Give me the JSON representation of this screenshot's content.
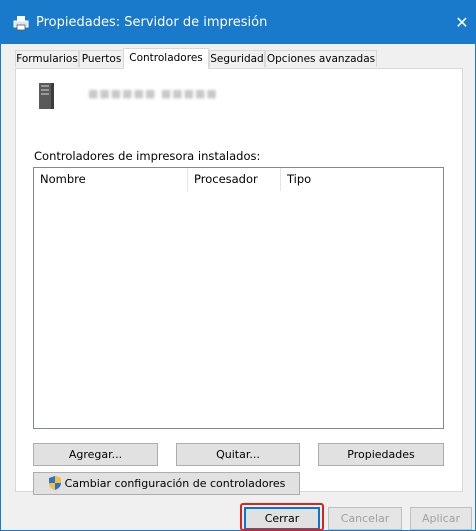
{
  "window": {
    "title": "Propiedades: Servidor de impresión",
    "close_label": "✕"
  },
  "tabs": [
    {
      "label": "Formularios"
    },
    {
      "label": "Puertos"
    },
    {
      "label": "Controladores"
    },
    {
      "label": "Seguridad"
    },
    {
      "label": "Opciones avanzadas"
    }
  ],
  "active_tab": "Controladores",
  "server": {
    "name": "■■■■■■ ■■■■■",
    "icon": "server-tower-icon"
  },
  "drivers": {
    "label": "Controladores de impresora instalados:",
    "columns": [
      "Nombre",
      "Procesador",
      "Tipo"
    ],
    "rows": []
  },
  "buttons": {
    "add": "Agregar...",
    "remove": "Quitar...",
    "properties": "Propiedades",
    "change_settings": "Cambiar configuración de controladores"
  },
  "footer": {
    "close": "Cerrar",
    "cancel": "Cancelar",
    "apply": "Aplicar"
  },
  "colors": {
    "titlebar": "#1979ca",
    "highlight": "#e0201b"
  }
}
